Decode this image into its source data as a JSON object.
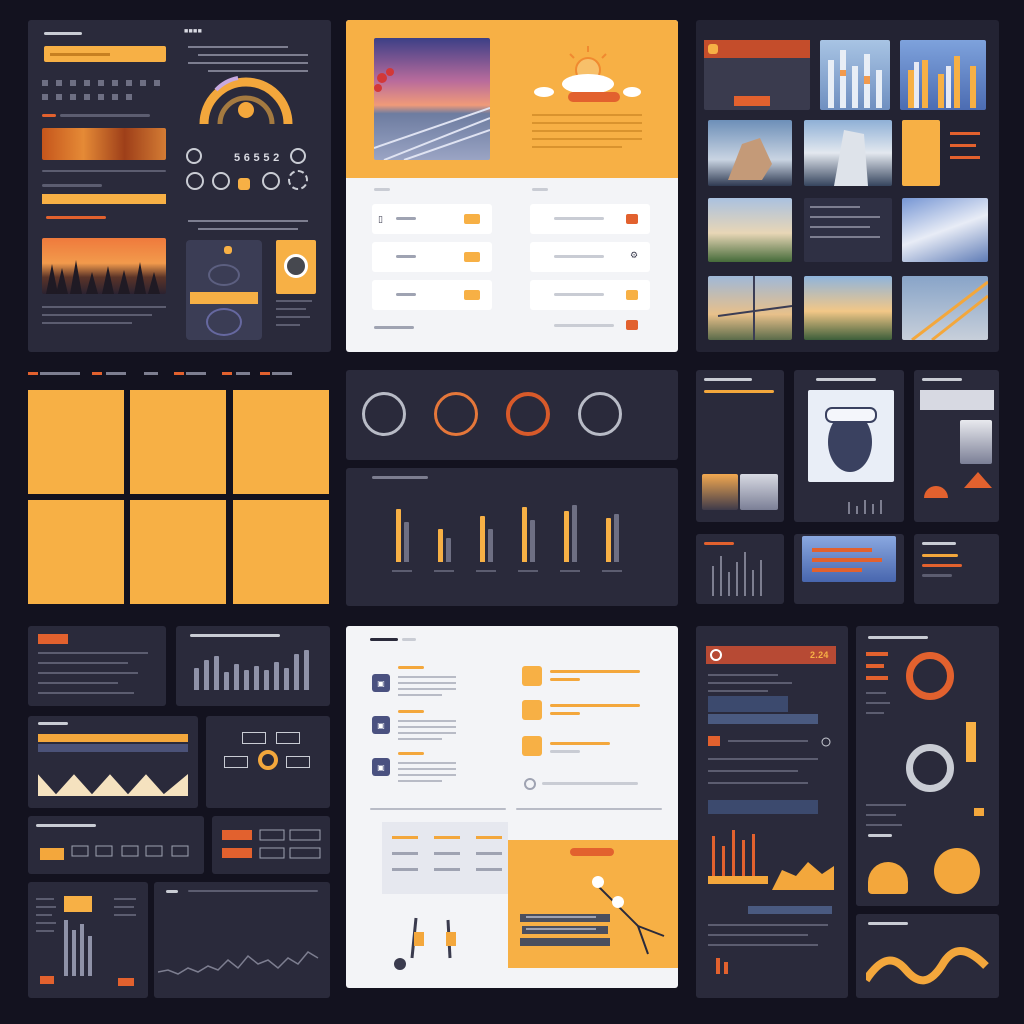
{
  "colors": {
    "background": "#13121f",
    "panel_dark": "#2a2a3b",
    "accent_orange": "#f7b045",
    "accent_red": "#e2612e",
    "panel_light": "#f3f4f7"
  },
  "panel_a": {
    "header": "■■■■",
    "stat_value": "5 6 5 5 2"
  },
  "panel_e": {
    "badge": "■■■■■■"
  },
  "panel_m": {
    "value": "2.24"
  },
  "icons": {
    "sun": "sun-icon",
    "cloud": "cloud-icon",
    "search": "search-icon",
    "gear": "gear-icon",
    "lock": "lock-icon",
    "mail": "mail-icon"
  },
  "chart_data": [
    {
      "type": "bar",
      "title": "",
      "series": [
        {
          "values": [
            48,
            30,
            42,
            50,
            46,
            40
          ]
        },
        {
          "values": [
            36,
            22,
            30,
            38,
            52,
            44
          ]
        }
      ],
      "categories": [
        "",
        "",
        "",
        "",
        "",
        ""
      ]
    },
    {
      "type": "bar",
      "title": "",
      "values": [
        22,
        30,
        34,
        18,
        26,
        20,
        24,
        20,
        28,
        22,
        36,
        40
      ],
      "categories": [
        "",
        "",
        "",
        "",
        "",
        "",
        "",
        "",
        "",
        "",
        "",
        ""
      ]
    }
  ]
}
